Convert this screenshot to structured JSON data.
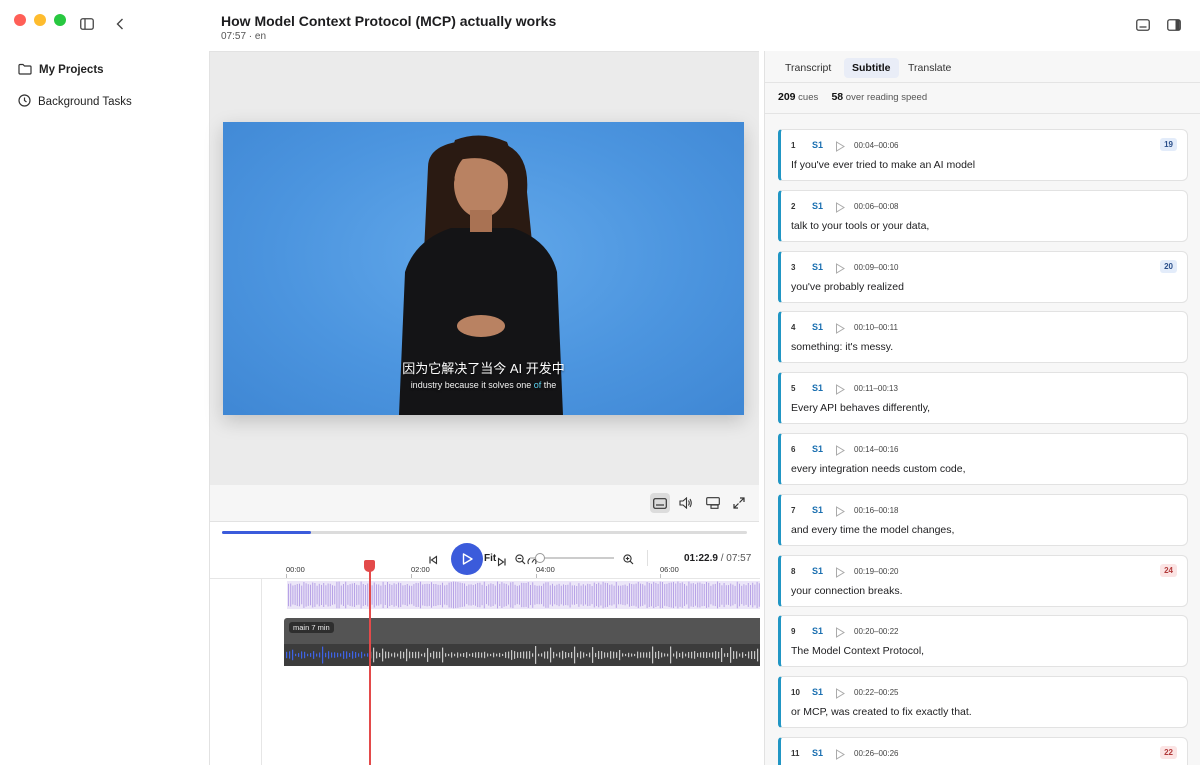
{
  "window": {
    "title": "How Model Context Protocol (MCP) actually works",
    "meta": "07:57 · en"
  },
  "sidebar": {
    "items": [
      {
        "label": "My Projects",
        "icon": "folder-icon"
      },
      {
        "label": "Background Tasks",
        "icon": "clock-icon"
      }
    ]
  },
  "video": {
    "subtitle_cn": "因为它解决了当今 AI 开发中",
    "subtitle_en_before": "industry because it solves one ",
    "subtitle_en_highlight": "of",
    "subtitle_en_after": " the"
  },
  "player": {
    "progress_fraction": 0.17,
    "fit_label": "Fit",
    "current_time": "01:22.9",
    "total_time": " / 07:57",
    "ruler_ticks": [
      "00:00",
      "02:00",
      "04:00",
      "06:00"
    ],
    "main_track_label": "main  7 min"
  },
  "panel": {
    "tabs": [
      "Transcript",
      "Subtitle",
      "Translate"
    ],
    "active_tab": "Subtitle",
    "stats": {
      "cues_count": "209",
      "cues_label": "cues",
      "over_count": "58",
      "over_label": "over reading speed"
    },
    "cues": [
      {
        "num": "1",
        "speaker": "S1",
        "time": "00:04–00:06",
        "text": "If you've ever tried to make an AI model",
        "badge": "19",
        "badge_color": "blue"
      },
      {
        "num": "2",
        "speaker": "S1",
        "time": "00:06–00:08",
        "text": "talk to your tools or your data,",
        "badge": "",
        "badge_color": ""
      },
      {
        "num": "3",
        "speaker": "S1",
        "time": "00:09–00:10",
        "text": "you've probably realized",
        "badge": "20",
        "badge_color": "blue"
      },
      {
        "num": "4",
        "speaker": "S1",
        "time": "00:10–00:11",
        "text": "something: it's messy.",
        "badge": "",
        "badge_color": ""
      },
      {
        "num": "5",
        "speaker": "S1",
        "time": "00:11–00:13",
        "text": "Every API behaves differently,",
        "badge": "",
        "badge_color": ""
      },
      {
        "num": "6",
        "speaker": "S1",
        "time": "00:14–00:16",
        "text": "every integration needs custom code,",
        "badge": "",
        "badge_color": ""
      },
      {
        "num": "7",
        "speaker": "S1",
        "time": "00:16–00:18",
        "text": "and every time the model changes,",
        "badge": "",
        "badge_color": ""
      },
      {
        "num": "8",
        "speaker": "S1",
        "time": "00:19–00:20",
        "text": "your connection breaks.",
        "badge": "24",
        "badge_color": "red"
      },
      {
        "num": "9",
        "speaker": "S1",
        "time": "00:20–00:22",
        "text": "The Model Context Protocol,",
        "badge": "",
        "badge_color": ""
      },
      {
        "num": "10",
        "speaker": "S1",
        "time": "00:22–00:25",
        "text": "or MCP, was created to fix exactly that.",
        "badge": "",
        "badge_color": ""
      },
      {
        "num": "11",
        "speaker": "S1",
        "time": "00:26–00:26",
        "text": "",
        "badge": "22",
        "badge_color": "red"
      }
    ]
  },
  "colors": {
    "accent": "#3b5bdb",
    "cue_bar": "#2196c4",
    "playhead": "#e34a4a"
  }
}
